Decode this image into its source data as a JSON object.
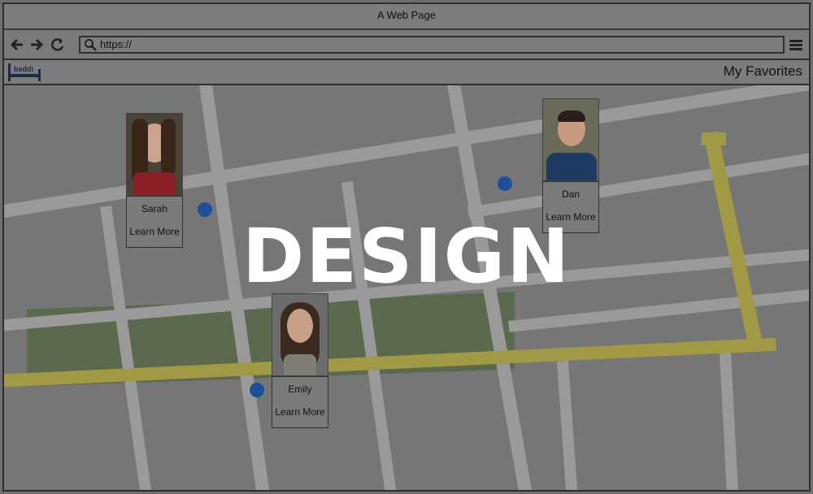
{
  "window": {
    "title": "A Web Page"
  },
  "toolbar": {
    "url": "https://",
    "back_icon": "back-arrow-icon",
    "forward_icon": "forward-arrow-icon",
    "reload_icon": "reload-icon",
    "menu_icon": "hamburger-menu-icon"
  },
  "app": {
    "logo_text": "beddi",
    "favorites_label": "My Favorites"
  },
  "profiles": [
    {
      "name": "Sarah",
      "action": "Learn More"
    },
    {
      "name": "Dan",
      "action": "Learn More"
    },
    {
      "name": "Emily",
      "action": "Learn More"
    }
  ],
  "overlay": {
    "title": "DESIGN"
  },
  "colors": {
    "pin": "#1e4f9a",
    "logo": "#1d2a4a",
    "park": "#5b6a4e",
    "highlight_road": "#a19a45"
  }
}
